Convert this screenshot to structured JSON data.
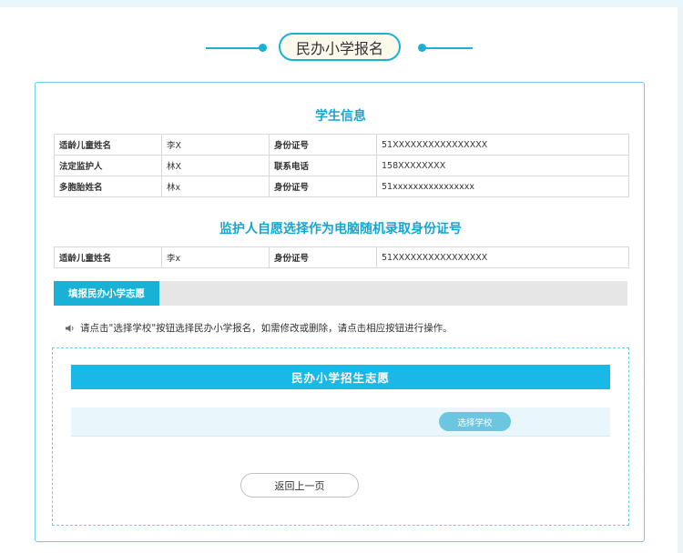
{
  "page_title": "民办小学报名",
  "student_section": {
    "title": "学生信息",
    "rows": [
      {
        "label1": "适龄儿童姓名",
        "value1": "李X",
        "label2": "身份证号",
        "value2": "51XXXXXXXXXXXXXXXX"
      },
      {
        "label1": "法定监护人",
        "value1": "林X",
        "label2": "联系电话",
        "value2": "158XXXXXXXX"
      },
      {
        "label1": "多胞胎姓名",
        "value1": "林x",
        "label2": "身份证号",
        "value2": "51xxxxxxxxxxxxxxxx"
      }
    ]
  },
  "guardian_section": {
    "title": "监护人自愿选择作为电脑随机录取身份证号",
    "rows": [
      {
        "label1": "适龄儿童姓名",
        "value1": "李x",
        "label2": "身份证号",
        "value2": "51XXXXXXXXXXXXXXXX"
      }
    ]
  },
  "tab": {
    "label": "填报民办小学志愿"
  },
  "notice": "请点击\"选择学校\"按钮选择民办小学报名，如需修改或删除，请点击相应按钮进行操作。",
  "wish_box": {
    "banner": "民办小学招生志愿",
    "select_button": "选择学校",
    "back_button": "返回上一页"
  },
  "colors": {
    "accent": "#1ab1d6",
    "banner": "#1ab8e6",
    "row_bg": "#e9f6fb"
  },
  "icons": {
    "notice": "speaker-icon"
  }
}
